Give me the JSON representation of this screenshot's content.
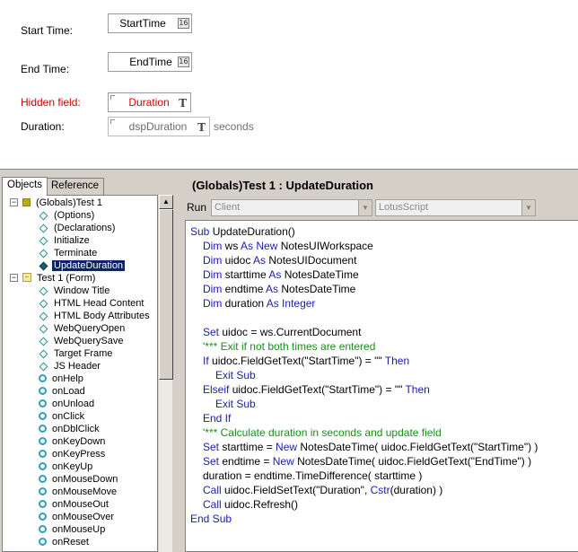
{
  "form": {
    "start_label": "Start Time:",
    "start_field": "StartTime",
    "end_label": "End Time:",
    "end_field": "EndTime",
    "hidden_label": "Hidden field:",
    "hidden_field": "Duration",
    "duration_label": "Duration:",
    "duration_field": "dspDuration",
    "duration_suffix": "seconds",
    "cal_icon": "16",
    "text_icon": "T"
  },
  "colors": {
    "hidden_label": "#d40000",
    "keyword": "#1b1bb0",
    "comment": "#1a8f1a",
    "selection": "#0a246a"
  },
  "left_panel": {
    "tabs": [
      "Objects",
      "Reference"
    ],
    "active_tab": "Objects",
    "tree": [
      {
        "label": "(Globals)Test 1",
        "icon": "globals-icon",
        "expander": "−"
      },
      {
        "label": "(Options)",
        "icon": "diamond-icon"
      },
      {
        "label": "(Declarations)",
        "icon": "diamond-icon"
      },
      {
        "label": "Initialize",
        "icon": "diamond-icon"
      },
      {
        "label": "Terminate",
        "icon": "diamond-icon"
      },
      {
        "label": "UpdateDuration",
        "icon": "diamond-icon",
        "selected": true
      },
      {
        "label": "Test 1 (Form)",
        "icon": "form-icon",
        "expander": "−"
      },
      {
        "label": "Window Title",
        "icon": "diamond-icon"
      },
      {
        "label": "HTML Head Content",
        "icon": "diamond-icon"
      },
      {
        "label": "HTML Body Attributes",
        "icon": "diamond-icon"
      },
      {
        "label": "WebQueryOpen",
        "icon": "diamond-icon"
      },
      {
        "label": "WebQuerySave",
        "icon": "diamond-icon"
      },
      {
        "label": "Target Frame",
        "icon": "diamond-icon"
      },
      {
        "label": "JS Header",
        "icon": "diamond-icon"
      },
      {
        "label": "onHelp",
        "icon": "circle-icon"
      },
      {
        "label": "onLoad",
        "icon": "circle-icon"
      },
      {
        "label": "onUnload",
        "icon": "circle-icon"
      },
      {
        "label": "onClick",
        "icon": "circle-icon"
      },
      {
        "label": "onDblClick",
        "icon": "circle-icon"
      },
      {
        "label": "onKeyDown",
        "icon": "circle-icon"
      },
      {
        "label": "onKeyPress",
        "icon": "circle-icon"
      },
      {
        "label": "onKeyUp",
        "icon": "circle-icon"
      },
      {
        "label": "onMouseDown",
        "icon": "circle-icon"
      },
      {
        "label": "onMouseMove",
        "icon": "circle-icon"
      },
      {
        "label": "onMouseOut",
        "icon": "circle-icon"
      },
      {
        "label": "onMouseOver",
        "icon": "circle-icon"
      },
      {
        "label": "onMouseUp",
        "icon": "circle-icon"
      },
      {
        "label": "onReset",
        "icon": "circle-icon"
      }
    ]
  },
  "right_panel": {
    "title": "(Globals)Test 1 : UpdateDuration",
    "run_label": "Run",
    "run_target": "Client",
    "language": "LotusScript",
    "code": [
      {
        "indent": 0,
        "parts": [
          [
            "kw",
            "Sub "
          ],
          [
            "t",
            "UpdateDuration()"
          ]
        ]
      },
      {
        "indent": 1,
        "parts": [
          [
            "kw",
            "Dim "
          ],
          [
            "t",
            "ws "
          ],
          [
            "kw",
            "As New "
          ],
          [
            "t",
            "NotesUIWorkspace"
          ]
        ]
      },
      {
        "indent": 1,
        "parts": [
          [
            "kw",
            "Dim "
          ],
          [
            "t",
            "uidoc "
          ],
          [
            "kw",
            "As "
          ],
          [
            "t",
            "NotesUIDocument"
          ]
        ]
      },
      {
        "indent": 1,
        "parts": [
          [
            "kw",
            "Dim "
          ],
          [
            "t",
            "starttime "
          ],
          [
            "kw",
            "As "
          ],
          [
            "t",
            "NotesDateTime"
          ]
        ]
      },
      {
        "indent": 1,
        "parts": [
          [
            "kw",
            "Dim "
          ],
          [
            "t",
            "endtime "
          ],
          [
            "kw",
            "As "
          ],
          [
            "t",
            "NotesDateTime"
          ]
        ]
      },
      {
        "indent": 1,
        "parts": [
          [
            "kw",
            "Dim "
          ],
          [
            "t",
            "duration "
          ],
          [
            "kw",
            "As Integer"
          ]
        ]
      },
      {
        "indent": 0,
        "parts": []
      },
      {
        "indent": 1,
        "parts": [
          [
            "kw",
            "Set "
          ],
          [
            "t",
            "uidoc = ws.CurrentDocument"
          ]
        ]
      },
      {
        "indent": 1,
        "parts": [
          [
            "cm",
            "'*** Exit if not both times are entered"
          ]
        ]
      },
      {
        "indent": 1,
        "parts": [
          [
            "kw",
            "If "
          ],
          [
            "t",
            "uidoc.FieldGetText(\"StartTime\") = \"\" "
          ],
          [
            "kw",
            "Then"
          ]
        ]
      },
      {
        "indent": 2,
        "parts": [
          [
            "kw",
            "Exit Sub"
          ]
        ]
      },
      {
        "indent": 1,
        "parts": [
          [
            "kw",
            "Elseif "
          ],
          [
            "t",
            "uidoc.FieldGetText(\"StartTime\") = \"\" "
          ],
          [
            "kw",
            "Then"
          ]
        ]
      },
      {
        "indent": 2,
        "parts": [
          [
            "kw",
            "Exit Sub"
          ]
        ]
      },
      {
        "indent": 1,
        "parts": [
          [
            "kw",
            "End If"
          ]
        ]
      },
      {
        "indent": 1,
        "parts": [
          [
            "cm",
            "'*** Calculate duration in seconds and update field"
          ]
        ]
      },
      {
        "indent": 1,
        "parts": [
          [
            "kw",
            "Set "
          ],
          [
            "t",
            "starttime = "
          ],
          [
            "kw",
            "New "
          ],
          [
            "t",
            "NotesDateTime( uidoc.FieldGetText(\"StartTime\") )"
          ]
        ]
      },
      {
        "indent": 1,
        "parts": [
          [
            "kw",
            "Set "
          ],
          [
            "t",
            "endtime = "
          ],
          [
            "kw",
            "New "
          ],
          [
            "t",
            "NotesDateTime( uidoc.FieldGetText(\"EndTime\") )"
          ]
        ]
      },
      {
        "indent": 1,
        "parts": [
          [
            "t",
            "duration = endtime.TimeDifference( starttime )"
          ]
        ]
      },
      {
        "indent": 1,
        "parts": [
          [
            "kw",
            "Call "
          ],
          [
            "t",
            "uidoc.FieldSetText(\"Duration\", "
          ],
          [
            "kw",
            "Cstr"
          ],
          [
            "t",
            "(duration) )"
          ]
        ]
      },
      {
        "indent": 1,
        "parts": [
          [
            "kw",
            "Call "
          ],
          [
            "t",
            "uidoc.Refresh()"
          ]
        ]
      },
      {
        "indent": 0,
        "parts": [
          [
            "kw",
            "End Sub"
          ]
        ]
      }
    ]
  }
}
